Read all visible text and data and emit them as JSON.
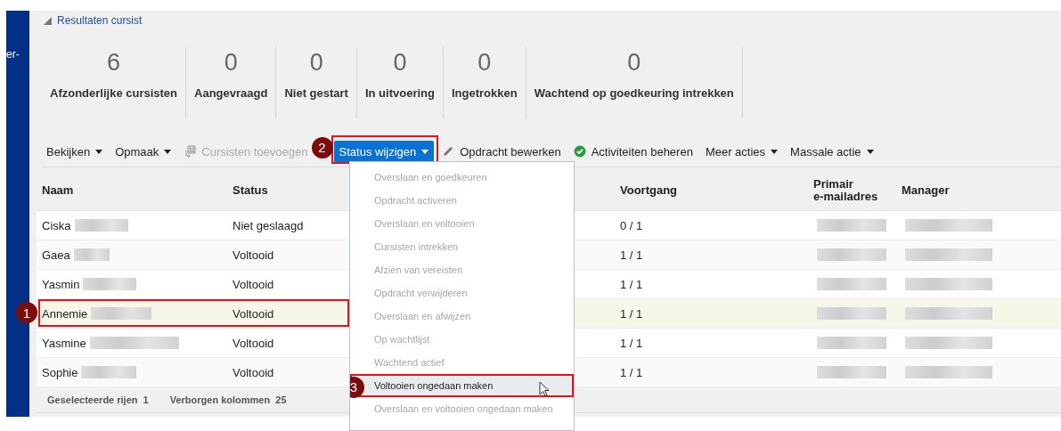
{
  "side_label": "er-",
  "section": {
    "title": "Resultaten cursist",
    "expanded": true
  },
  "stats": [
    {
      "value": "6",
      "label": "Afzonderlijke cursisten"
    },
    {
      "value": "0",
      "label": "Aangevraagd"
    },
    {
      "value": "0",
      "label": "Niet gestart"
    },
    {
      "value": "0",
      "label": "In uitvoering"
    },
    {
      "value": "0",
      "label": "Ingetrokken"
    },
    {
      "value": "0",
      "label": "Wachtend op goedkeuring intrekken"
    }
  ],
  "toolbar": [
    {
      "kind": "menu",
      "label": "Bekijken",
      "disabled": false
    },
    {
      "kind": "menu",
      "label": "Opmaak",
      "disabled": false
    },
    {
      "kind": "icon-action",
      "label": "Cursisten toevoegen",
      "disabled": true
    },
    {
      "kind": "primary",
      "label": "Status wijzigen",
      "disabled": false,
      "callout": "2"
    },
    {
      "kind": "edit",
      "label": "Opdracht bewerken",
      "disabled": false
    },
    {
      "kind": "check",
      "label": "Activiteiten beheren",
      "disabled": false
    },
    {
      "kind": "menu",
      "label": "Meer acties",
      "disabled": false
    },
    {
      "kind": "menu",
      "label": "Massale actie",
      "disabled": false
    }
  ],
  "table": {
    "columns": [
      "Naam",
      "Status",
      "Voortgang",
      "Primair e-mailadres",
      "Manager"
    ],
    "rows": [
      {
        "name": "Ciska",
        "status": "Niet geslaagd",
        "progress": "0 / 1",
        "selected": false
      },
      {
        "name": "Gaea",
        "status": "Voltooid",
        "progress": "1 / 1",
        "selected": false
      },
      {
        "name": "Yasmin",
        "status": "Voltooid",
        "progress": "1 / 1",
        "selected": false
      },
      {
        "name": "Annemie",
        "status": "Voltooid",
        "progress": "1 / 1",
        "selected": true,
        "callout": "1"
      },
      {
        "name": "Yasmine",
        "status": "Voltooid",
        "progress": "1 / 1",
        "selected": false
      },
      {
        "name": "Sophie",
        "status": "Voltooid",
        "progress": "1 / 1",
        "selected": false
      }
    ]
  },
  "footer": [
    {
      "label": "Geselecteerde rijen",
      "value": "1"
    },
    {
      "label": "Verborgen kolommen",
      "value": "25"
    }
  ],
  "menu": [
    {
      "label": "Overslaan en goedkeuren",
      "disabled": true,
      "selected": false
    },
    {
      "label": "Opdracht activeren",
      "disabled": true,
      "selected": false
    },
    {
      "label": "Overslaan en voltooien",
      "disabled": true,
      "selected": false
    },
    {
      "label": "Cursisten intrekken",
      "disabled": true,
      "selected": false
    },
    {
      "label": "Afzien van vereisten",
      "disabled": true,
      "selected": false
    },
    {
      "label": "Opdracht verwijderen",
      "disabled": true,
      "selected": false
    },
    {
      "label": "Overslaan en afwijzen",
      "disabled": true,
      "selected": false
    },
    {
      "label": "Op wachtlijst",
      "disabled": true,
      "selected": false
    },
    {
      "label": "Wachtend actief",
      "disabled": true,
      "selected": false
    },
    {
      "label": "Voltooien ongedaan maken",
      "disabled": false,
      "selected": true,
      "callout": "3"
    },
    {
      "label": "Overslaan en voltooien ongedaan maken",
      "disabled": true,
      "selected": false
    }
  ]
}
